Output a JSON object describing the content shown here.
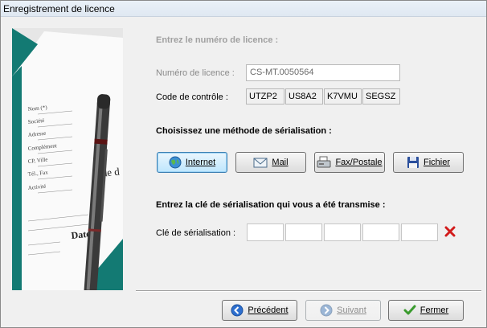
{
  "window": {
    "title": "Enregistrement de licence"
  },
  "license": {
    "heading": "Entrez le numéro de licence :",
    "number_label": "Numéro de licence :",
    "number_value": "CS-MT.0050564",
    "check_label": "Code de contrôle :",
    "check_codes": [
      "UTZP2",
      "US8A2",
      "K7VMU",
      "SEGSZ"
    ]
  },
  "method": {
    "heading": "Choisissez une méthode de sérialisation :",
    "buttons": {
      "internet": {
        "label": "Internet",
        "icon": "globe-icon"
      },
      "mail": {
        "label": "Mail",
        "icon": "envelope-icon"
      },
      "fax": {
        "label": "Fax/Postale",
        "icon": "fax-icon"
      },
      "file": {
        "label": "Fichier",
        "icon": "floppy-disk-icon"
      }
    }
  },
  "serial": {
    "heading": "Entrez la clé de sérialisation qui vous a été transmise :",
    "label": "Clé de sérialisation :",
    "cells": [
      "",
      "",
      "",
      "",
      ""
    ],
    "clear_icon": "red-x-icon"
  },
  "side_image": {
    "icon": "registration-form-and-pen-image",
    "form_labels": [
      "Nom (*)",
      "Société",
      "Adresse",
      "Complément",
      "CP, Ville",
      "Tél., Fax",
      "Activité"
    ],
    "form_heading": "code d",
    "form_date": "Date d"
  },
  "nav": {
    "previous": {
      "label": "Précédent",
      "icon": "arrow-left-icon"
    },
    "next": {
      "label": "Suivant",
      "icon": "arrow-right-icon"
    },
    "close": {
      "label": "Fermer",
      "icon": "check-mark-icon"
    }
  },
  "colors": {
    "teal": "#137a73",
    "accent_blue": "#3c7fb1",
    "clear_red": "#d21c1c"
  }
}
